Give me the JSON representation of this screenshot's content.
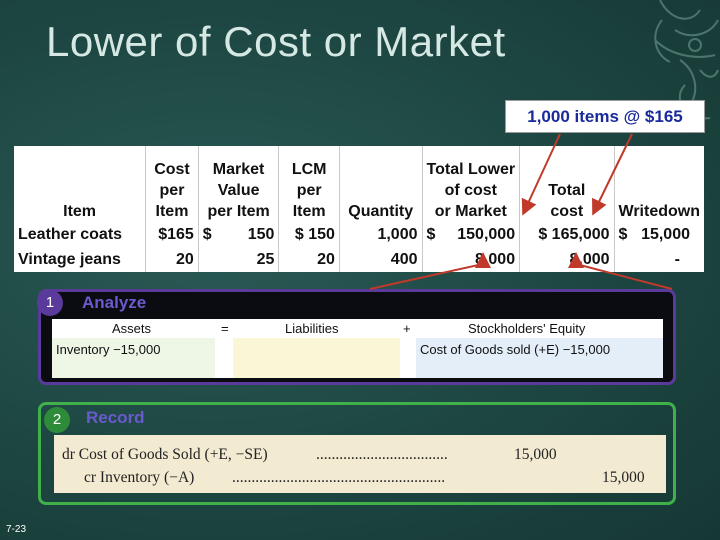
{
  "title": "Lower of Cost or Market",
  "callout": "1,000 items @ $165",
  "table": {
    "headers": {
      "item": "Item",
      "cost_per_item": [
        "Cost",
        "per",
        "Item"
      ],
      "market_value": [
        "Market",
        "Value",
        "per Item"
      ],
      "lcm_per_item": [
        "LCM",
        "per",
        "Item"
      ],
      "quantity": "Quantity",
      "total_lower": [
        "Total Lower",
        "of cost",
        "or Market"
      ],
      "total_cost": [
        "Total",
        "cost"
      ],
      "writedown": "Writedown"
    },
    "rows": [
      {
        "item": "Leather coats",
        "cost": "$165",
        "mv_sym": "$",
        "mv": "150",
        "lcm": "$ 150",
        "qty": "1,000",
        "tl_sym": "$",
        "tl": "150,000",
        "tc": "$ 165,000",
        "wd_sym": "$",
        "wd": "15,000"
      },
      {
        "item": "Vintage jeans",
        "cost": "20",
        "mv_sym": "",
        "mv": "25",
        "lcm": "20",
        "qty": "400",
        "tl_sym": "",
        "tl": "8,000",
        "tc": "8,000",
        "wd_sym": "",
        "wd": "-"
      }
    ]
  },
  "analyze": {
    "number": "1",
    "label": "Analyze",
    "assets": "Assets",
    "equals": "=",
    "liabilities": "Liabilities",
    "plus": "+",
    "equity": "Stockholders' Equity",
    "assets_entry": "Inventory −15,000",
    "equity_entry": "Cost of Goods sold (+E)  −15,000"
  },
  "record": {
    "number": "2",
    "label": "Record",
    "debit_line": "dr Cost of Goods Sold (+E, −SE)",
    "debit_dots": "..................................",
    "debit_amount": "15,000",
    "credit_line": "cr Inventory (−A)",
    "credit_dots": ".......................................................",
    "credit_amount": "15,000"
  },
  "slide_number": "7-23",
  "colors": {
    "background": "#1c4440",
    "callout_text": "#1a2a9a",
    "arrow": "#c0392b",
    "analyze_border": "#5a3a9a",
    "record_border": "#3fb04a"
  }
}
